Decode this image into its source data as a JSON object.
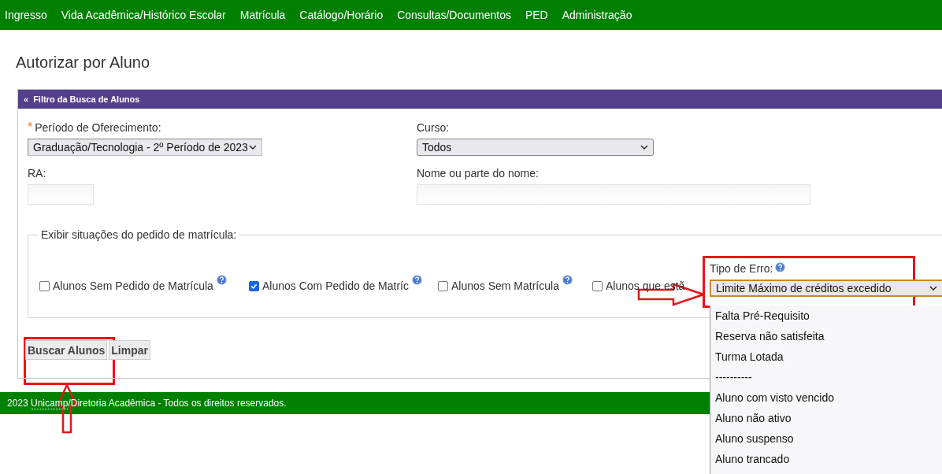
{
  "nav": {
    "items": [
      "Ingresso",
      "Vida Acadêmica/Histórico Escolar",
      "Matrícula",
      "Catálogo/Horário",
      "Consultas/Documentos",
      "PED",
      "Administração"
    ]
  },
  "page_title": "Autorizar por Aluno",
  "panel": {
    "toggle": "«",
    "title": "Filtro da Busca de Alunos"
  },
  "fields": {
    "periodo": {
      "required_mark": "*",
      "label": "Período de Oferecimento:",
      "value": "Graduação/Tecnologia - 2º Período de 2023"
    },
    "curso": {
      "label": "Curso:",
      "value": "Todos"
    },
    "ra": {
      "label": "RA:"
    },
    "nome": {
      "label": "Nome ou parte do nome:"
    }
  },
  "situacoes": {
    "legend": "Exibir situações do pedido de matrícula:",
    "options": [
      {
        "label": "Alunos Sem Pedido de Matrícula",
        "checked": false,
        "help": true
      },
      {
        "label": "Alunos Com Pedido de Matríc",
        "checked": true,
        "help": true
      },
      {
        "label": "Alunos Sem Matrícula",
        "checked": false,
        "help": true
      },
      {
        "label": "Alunos que estã",
        "checked": false,
        "help": false
      }
    ]
  },
  "tipo_erro": {
    "label": "Tipo de Erro:",
    "value": "Limite Máximo de créditos excedido",
    "options": [
      "Falta Pré-Requisito",
      "Reserva não satisfeita",
      "Turma Lotada",
      "----------",
      "Aluno com visto vencido",
      "Aluno não ativo",
      "Aluno suspenso",
      "Aluno trancado"
    ]
  },
  "buttons": [
    "Buscar Alunos",
    "Limpar"
  ],
  "footer": {
    "prefix": "2023",
    "abbr": "Unicamp",
    "text": "/Diretoria Acadêmica - Todos os direitos reservados."
  }
}
